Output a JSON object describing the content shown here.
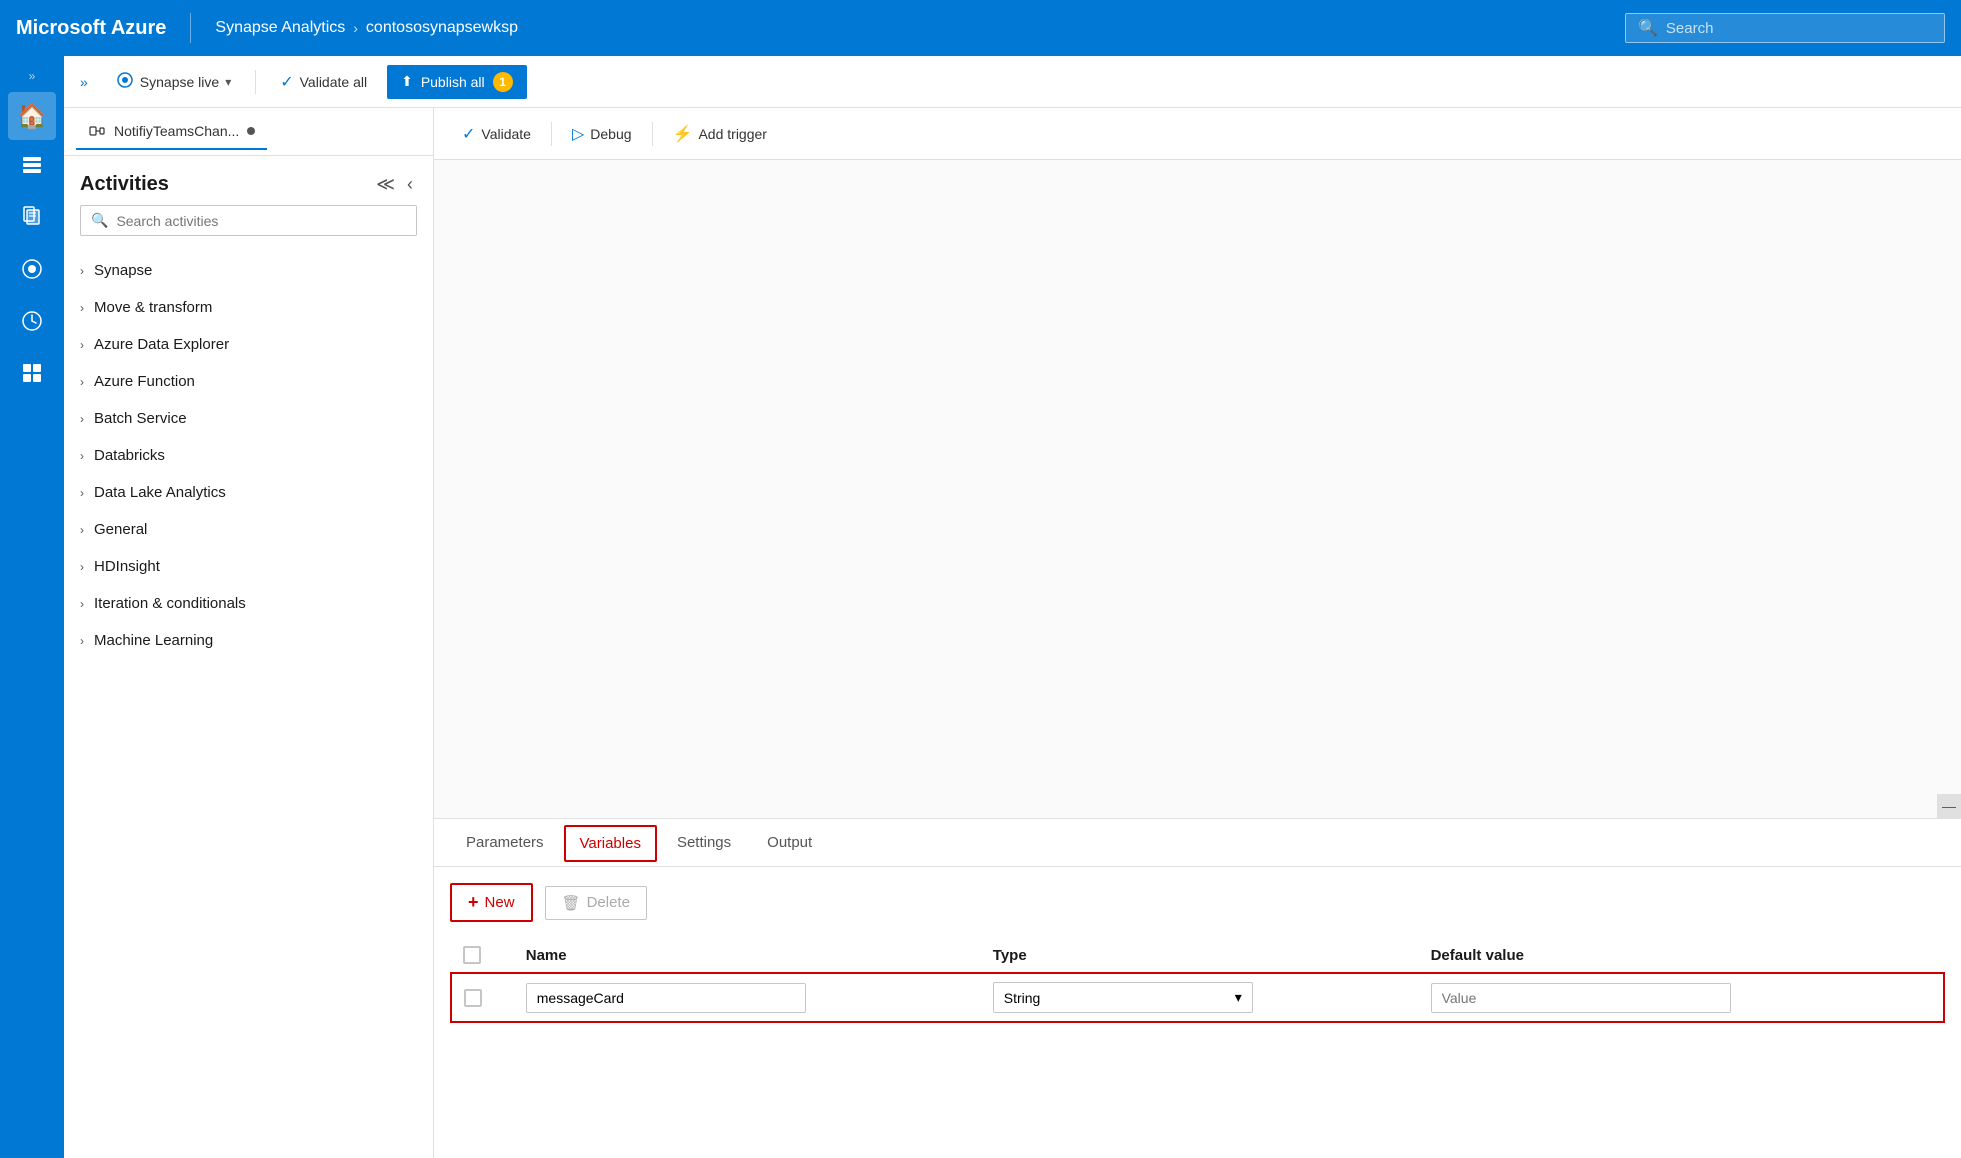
{
  "topbar": {
    "brand": "Microsoft Azure",
    "service": "Synapse Analytics",
    "workspace": "contososynapsewksp",
    "search_placeholder": "Search"
  },
  "secondary_toolbar": {
    "expand_label": "»",
    "synapse_live": "Synapse live",
    "validate_all": "Validate all",
    "publish_all": "Publish all",
    "publish_badge": "1"
  },
  "pipeline_tab": {
    "label": "NotifiyTeamsChan...",
    "dot": true
  },
  "activities_panel": {
    "title": "Activities",
    "search_placeholder": "Search activities",
    "items": [
      {
        "label": "Synapse"
      },
      {
        "label": "Move & transform"
      },
      {
        "label": "Azure Data Explorer"
      },
      {
        "label": "Azure Function"
      },
      {
        "label": "Batch Service"
      },
      {
        "label": "Databricks"
      },
      {
        "label": "Data Lake Analytics"
      },
      {
        "label": "General"
      },
      {
        "label": "HDInsight"
      },
      {
        "label": "Iteration & conditionals"
      },
      {
        "label": "Machine Learning"
      }
    ]
  },
  "canvas_toolbar": {
    "validate": "Validate",
    "debug": "Debug",
    "add_trigger": "Add trigger"
  },
  "bottom_tabs": [
    {
      "label": "Parameters",
      "active": false
    },
    {
      "label": "Variables",
      "active": true,
      "outlined": true
    },
    {
      "label": "Settings",
      "active": false
    },
    {
      "label": "Output",
      "active": false
    }
  ],
  "variables": {
    "new_label": "+ New",
    "delete_label": "Delete",
    "columns": [
      "Name",
      "Type",
      "Default value"
    ],
    "rows": [
      {
        "name": "messageCard",
        "type": "String",
        "default_value": "Value",
        "outlined": true
      }
    ]
  },
  "icons": {
    "home": "⌂",
    "storage": "🗄",
    "pipeline": "⊡",
    "data": "◉",
    "monitor": "⚙",
    "manage": "🔧",
    "search": "🔍",
    "chevron_right": "›",
    "chevron_down": "∨",
    "collapse_double": "«",
    "collapse_single": "‹",
    "check": "✓",
    "debug_play": "▷",
    "lightning": "⚡",
    "upload": "⬆",
    "trash": "🗑",
    "plus": "+",
    "expand": "»"
  },
  "sidebar_items": [
    {
      "id": "expand",
      "label": "»"
    },
    {
      "id": "home",
      "label": "⌂"
    },
    {
      "id": "storage",
      "label": "🗄"
    },
    {
      "id": "pipeline",
      "label": "⊡"
    },
    {
      "id": "data",
      "label": "◉"
    },
    {
      "id": "monitor",
      "label": "◌"
    },
    {
      "id": "manage",
      "label": "⊞"
    }
  ]
}
